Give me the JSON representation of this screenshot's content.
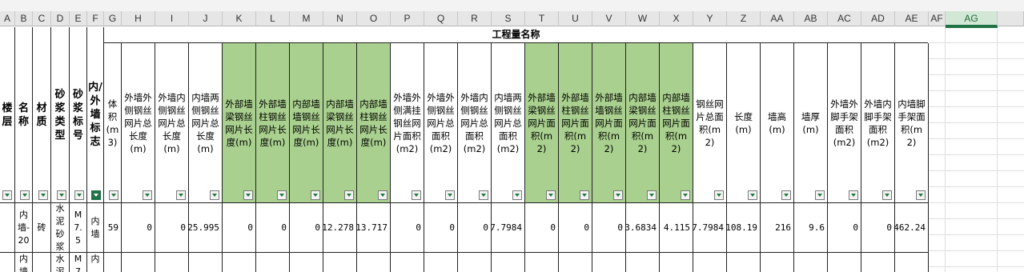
{
  "column_letters": [
    "A",
    "B",
    "C",
    "D",
    "E",
    "F",
    "G",
    "H",
    "I",
    "J",
    "K",
    "L",
    "M",
    "N",
    "O",
    "P",
    "Q",
    "R",
    "S",
    "T",
    "U",
    "V",
    "W",
    "X",
    "Y",
    "Z",
    "AA",
    "AB",
    "AC",
    "AD",
    "AE",
    "AF",
    "AG"
  ],
  "selected_column": "AG",
  "section_title": "工程量名称",
  "headers": [
    "楼层",
    "名称",
    "材质",
    "砂浆类型",
    "砂浆标号",
    "内/外墙标志",
    "体积(m3)",
    "外墙外侧钢丝网片总长度(m)",
    "外墙内侧钢丝网片总长度(m)",
    "内墙两侧钢丝网片总长度(m)",
    "外部墙梁钢丝网片长度(m)",
    "外部墙柱钢丝网片长度(m)",
    "内部墙墙钢丝网片长度(m)",
    "内部墙梁钢丝网片长度(m)",
    "内部墙柱钢丝网片长度(m)",
    "外墙外侧满挂钢丝网片面积(m2)",
    "外墙外侧钢丝网片总面积(m2)",
    "外墙内侧钢丝网片总面积(m2)",
    "内墙两侧钢丝网片总面积(m2)",
    "外部墙梁钢丝网片面积(m2)",
    "外部墙柱钢丝网片面积(m2)",
    "外部墙墙钢丝网片面积(m2)",
    "内部墙梁钢丝网片面积(m2)",
    "内部墙柱钢丝网片面积(m2)",
    "钢丝网片总面积(m2)",
    "长度(m)",
    "墙高(m)",
    "墙厚(m)",
    "外墙外脚手架面积(m2)",
    "外墙内脚手架面积(m2)",
    "内墙脚手架面积(m2)"
  ],
  "row1": [
    "",
    "内墙-20",
    "砖",
    "水泥砂浆",
    "M7.5",
    "内墙",
    "59",
    "0",
    "0",
    "25.995",
    "0",
    "0",
    "0",
    "12.278",
    "13.717",
    "0",
    "0",
    "0",
    "7.7984",
    "0",
    "0",
    "0",
    "3.6834",
    "4.115",
    "7.7984",
    "108.19",
    "216",
    "9.6",
    "0",
    "0",
    "462.24"
  ],
  "row2": [
    "",
    "内墙",
    "",
    "水泥",
    "M7",
    "内",
    "",
    "",
    "",
    "",
    "",
    "",
    "",
    "",
    "",
    "",
    "",
    "",
    "",
    "",
    "",
    "",
    "",
    "",
    "",
    "",
    "",
    "",
    "",
    "",
    ""
  ],
  "colors": {
    "green_header": "#a9d08e",
    "selected_col": "#217346"
  }
}
